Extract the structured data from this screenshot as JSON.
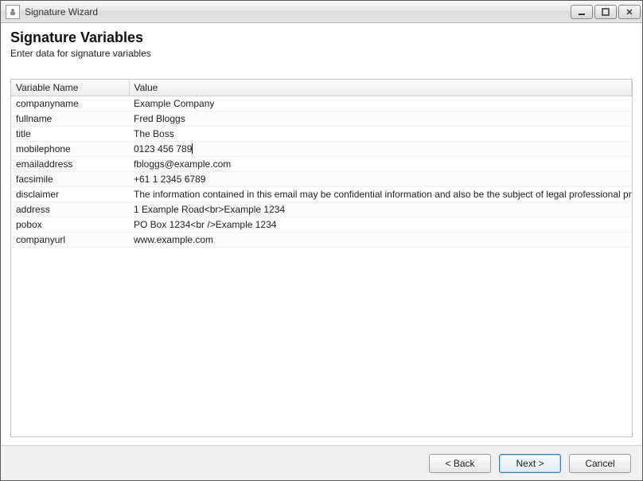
{
  "window": {
    "title": "Signature Wizard"
  },
  "header": {
    "heading": "Signature Variables",
    "subtitle": "Enter data for signature variables"
  },
  "table": {
    "columns": {
      "name": "Variable Name",
      "value": "Value"
    },
    "rows": [
      {
        "name": "companyname",
        "value": "Example Company"
      },
      {
        "name": "fullname",
        "value": "Fred Bloggs"
      },
      {
        "name": "title",
        "value": "The Boss"
      },
      {
        "name": "mobilephone",
        "value": "0123 456 789",
        "editing": true
      },
      {
        "name": "emailaddress",
        "value": "fbloggs@example.com"
      },
      {
        "name": "facsimile",
        "value": " +61 1 2345 6789"
      },
      {
        "name": "disclaimer",
        "value": "The information contained in this email may be confidential information and also be the subject of legal professional privilege. If y"
      },
      {
        "name": "address",
        "value": "1 Example Road<br>Example 1234"
      },
      {
        "name": "pobox",
        "value": "PO Box 1234<br />Example 1234"
      },
      {
        "name": "companyurl",
        "value": "www.example.com"
      }
    ]
  },
  "footer": {
    "back": "< Back",
    "next": "Next >",
    "cancel": "Cancel"
  }
}
